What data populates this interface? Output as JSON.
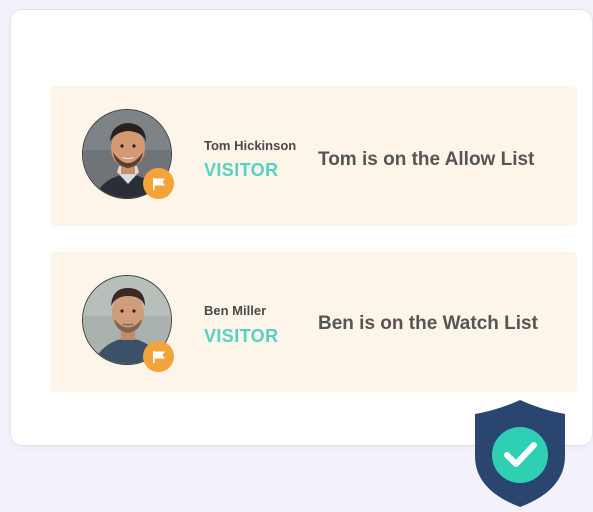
{
  "visitors": [
    {
      "name": "Tom Hickinson",
      "role": "VISITOR",
      "status": "Tom is on the Allow List"
    },
    {
      "name": "Ben Miller",
      "role": "VISITOR",
      "status": "Ben is on the Watch List"
    }
  ],
  "icons": {
    "flag": "flag-icon",
    "shield": "shield-check-icon"
  },
  "colors": {
    "row_background": "#fdf5e9",
    "role_text": "#56d0c1",
    "flag_badge": "#f2a43a",
    "shield": "#2b4571",
    "check_circle": "#2fcfb4"
  }
}
